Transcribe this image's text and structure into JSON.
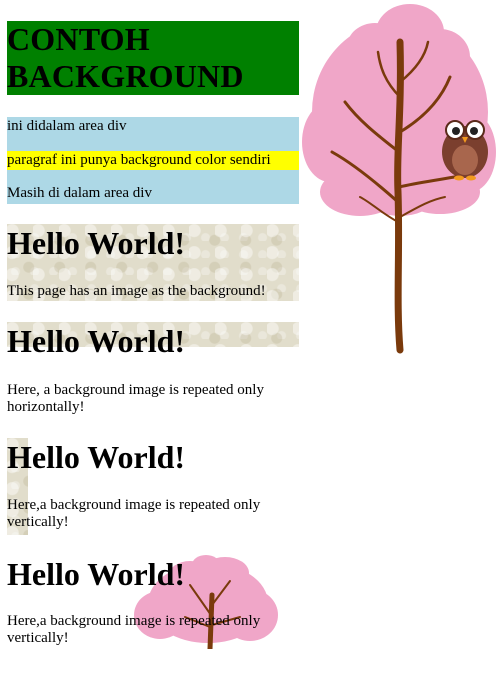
{
  "title": "CONTOH BACKGROUND",
  "div_area": {
    "line1": "ini didalam area div",
    "line2": "paragraf ini punya background color sendiri",
    "line3": "Masih di dalam area div"
  },
  "sections": [
    {
      "heading": "Hello World!",
      "text": "This page has an image as the background!"
    },
    {
      "heading": "Hello World!",
      "text": "Here, a background image is repeated only horizontally!"
    },
    {
      "heading": "Hello World!",
      "text": "Here,a background image is repeated only vertically!"
    },
    {
      "heading": "Hello World!",
      "text": "Here,a background image is repeated only vertically!"
    }
  ],
  "colors": {
    "title_bg": "#008000",
    "div_bg": "#add8e6",
    "paragraph_bg": "#ffff00",
    "texture": "#e1ddcb",
    "blossom": "#f0a6c8",
    "trunk": "#7a3a0c",
    "owl": "#7b3f2e"
  }
}
